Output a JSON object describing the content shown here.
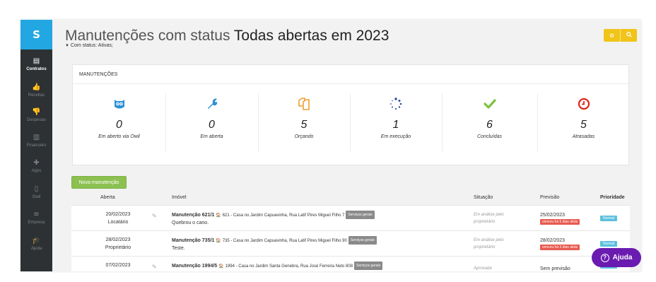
{
  "sidebar": {
    "logo": "S",
    "items": [
      {
        "label": "Contratos",
        "icon": "document-icon",
        "glyph": "▤",
        "active": true
      },
      {
        "label": "Receitas",
        "icon": "thumbs-up-icon",
        "glyph": "👍",
        "active": false
      },
      {
        "label": "Despesas",
        "icon": "thumbs-down-icon",
        "glyph": "👎",
        "active": false
      },
      {
        "label": "Financeiro",
        "icon": "bar-chart-icon",
        "glyph": "▥",
        "active": false
      },
      {
        "label": "Apps",
        "icon": "puzzle-icon",
        "glyph": "✚",
        "active": false
      },
      {
        "label": "Owil",
        "icon": "mobile-icon",
        "glyph": "▯",
        "active": false
      },
      {
        "label": "Empresa",
        "icon": "menu-icon",
        "glyph": "≡",
        "active": false
      },
      {
        "label": "Ajuda",
        "icon": "graduation-cap-icon",
        "glyph": "🎓",
        "active": false
      }
    ]
  },
  "header": {
    "title_prefix": "Manutenções com status ",
    "title_strong": "Todas abertas em 2023",
    "filter_icon": "▼",
    "subtitle": "Com status: Ativas;",
    "settings_icon": "⚙",
    "search_icon": "🔍"
  },
  "panel": {
    "title": "MANUTENÇÕES",
    "stats": [
      {
        "value": "0",
        "label": "Em aberto via Owil",
        "color": "#2b8fd6",
        "icon": "owl-icon"
      },
      {
        "value": "0",
        "label": "Em aberta",
        "color": "#2b8fd6",
        "icon": "wrench-icon"
      },
      {
        "value": "5",
        "label": "Orçando",
        "color": "#f0a030",
        "icon": "copy-icon"
      },
      {
        "value": "1",
        "label": "Em execução",
        "color": "#2a4f9a",
        "icon": "spinner-icon"
      },
      {
        "value": "6",
        "label": "Concluídas",
        "color": "#7dc243",
        "icon": "check-icon"
      },
      {
        "value": "5",
        "label": "Atrasadas",
        "color": "#e2231a",
        "icon": "clock-icon"
      }
    ]
  },
  "new_button": "Nova manutenção",
  "table": {
    "headers": {
      "aberta": "Aberta",
      "imovel": "Imóvel",
      "situacao": "Situação",
      "previsao": "Previsão",
      "prioridade": "Prioridade"
    },
    "rows": [
      {
        "date": "20/02/2023",
        "by": "Locatário",
        "title": "Manutenção 621/1",
        "addr_icon": "🏠",
        "addr": "621 - Casa no Jardim Capuavinha, Rua Latif Pires Miguel Filho 7",
        "tag": "Serviços gerais",
        "desc": "Quebrou o cano.",
        "sit1": "Em análise pelo",
        "sit2": "proprietário",
        "prev_date": "25/02/2023",
        "prev_tag": "venceu há 5 dias atrás",
        "prio": "Normal"
      },
      {
        "date": "28/02/2023",
        "by": "Proprietário",
        "title": "Manutenção 735/1",
        "addr_icon": "🏠",
        "addr": "735 - Casa no Jardim Capuavinha, Rua Latif Pires Miguel Filho 90",
        "tag": "Serviços gerais",
        "desc": "Teste.",
        "sit1": "Em análise pelo",
        "sit2": "proprietário",
        "prev_date": "28/02/2023",
        "prev_tag": "venceu há 3 dias atrás",
        "prio": "Normal"
      },
      {
        "date": "07/02/2023",
        "by": "",
        "title": "Manutenção 1994/5",
        "addr_icon": "🏠",
        "addr": "1994 - Casa no Jardim Santa Genebra, Rua José Ferreira Neto 808",
        "tag": "Serviços gerais",
        "desc": "",
        "sit1": "Aprovada",
        "sit2": "",
        "prev_date": "Sem previsão",
        "prev_tag": "",
        "prio": "Normal"
      }
    ]
  },
  "help_button": {
    "label": "Ajuda",
    "icon": "?"
  }
}
